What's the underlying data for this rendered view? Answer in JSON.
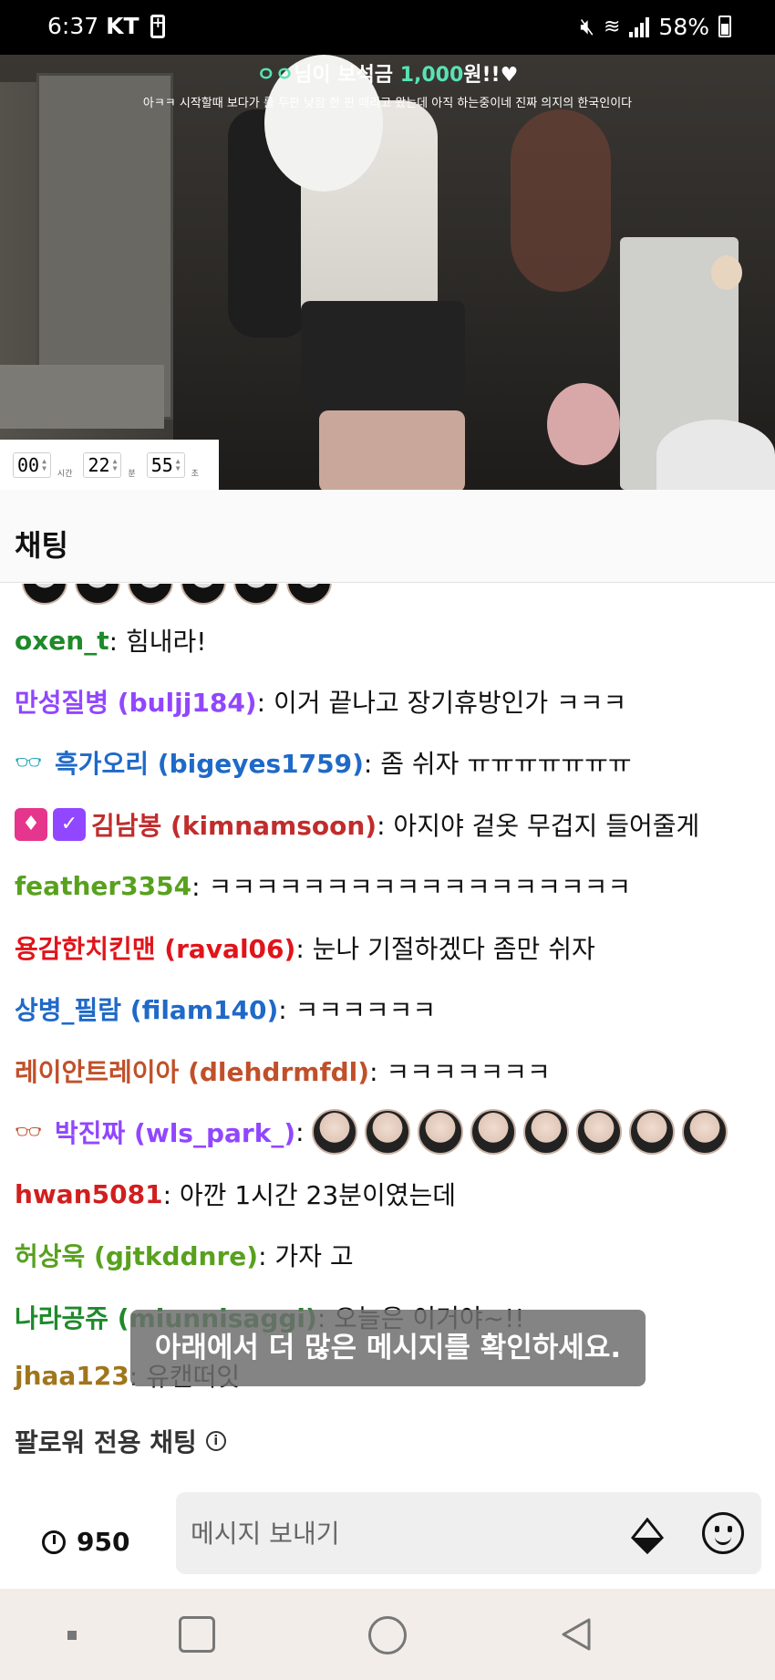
{
  "status_bar": {
    "time": "6:37",
    "carrier": "KT",
    "battery": "58%"
  },
  "video": {
    "donation_name": "ㅇㅇ",
    "donation_text": "님이 보석금 ",
    "donation_amount": "1,000",
    "donation_suffix": "원!!♥",
    "donation_message": "아ㅋㅋ 시작할때 보다가 롤 두판 낮잠 한 판 때리고 왔는데 아직 하는중이네 진짜 의지의 한국인이다",
    "timer": {
      "hours": "00",
      "hours_unit": "시간",
      "minutes": "22",
      "minutes_unit": "분",
      "seconds": "55",
      "seconds_unit": "초"
    }
  },
  "chat": {
    "title": "채팅",
    "messages": [
      {
        "user": "oxen_t",
        "text": ": 힘내라!",
        "color": "#1e8a2a"
      },
      {
        "user": "만성질병 (buljj184)",
        "text": ": 이거 끝나고 장기휴방인가 ㅋㅋㅋ",
        "color": "#9146ff"
      },
      {
        "user": "흑가오리 (bigeyes1759)",
        "text": ": 좀 쉬자 ㅠㅠㅠㅠㅠㅠㅠ",
        "color": "#1f69c8"
      },
      {
        "user": "김남봉 (kimnamsoon)",
        "text": ": 아지야 겉옷 무겁지 들어줄게",
        "color": "#c12c2c"
      },
      {
        "user": "feather3354",
        "text": ": ㅋㅋㅋㅋㅋㅋㅋㅋㅋㅋㅋㅋㅋㅋㅋㅋㅋㅋ",
        "color": "#58a11e"
      },
      {
        "user": "용감한치킨맨 (raval06)",
        "text": ": 눈나 기절하겠다 좀만 쉬자",
        "color": "#e0141a"
      },
      {
        "user": "상병_필람 (filam140)",
        "text": ": ㅋㅋㅋㅋㅋㅋ",
        "color": "#1f69c8"
      },
      {
        "user": "레이안트레이아 (dlehdrmfdl)",
        "text": ": ㅋㅋㅋㅋㅋㅋㅋ",
        "color": "#c0502a"
      },
      {
        "user": "박진짜 (wls_park_)",
        "text": ":",
        "color": "#9146ff"
      },
      {
        "user": "hwan5081",
        "text": ": 아깐 1시간 23분이였는데",
        "color": "#d11e1e"
      },
      {
        "user": "허상욱 (gjtkddnre)",
        "text": ": 가자 고",
        "color": "#58a11e"
      },
      {
        "user": "나라공쥬 (miunnisaggi)",
        "text": ": 오늘은 이거야~!!",
        "color": "#1e8a2a"
      },
      {
        "user": "jhaa123",
        "text": ": 유캔떠잇",
        "color": "#a0761c"
      }
    ],
    "toast": "아래에서 더 많은 메시지를 확인하세요.",
    "follower_only": "팔로워 전용 채팅"
  },
  "input": {
    "points": "950",
    "placeholder": "메시지 보내기"
  },
  "icons": {
    "points": "channel-points-icon",
    "bits": "bits-icon",
    "emote": "emote-picker-icon",
    "info": "info-icon"
  }
}
